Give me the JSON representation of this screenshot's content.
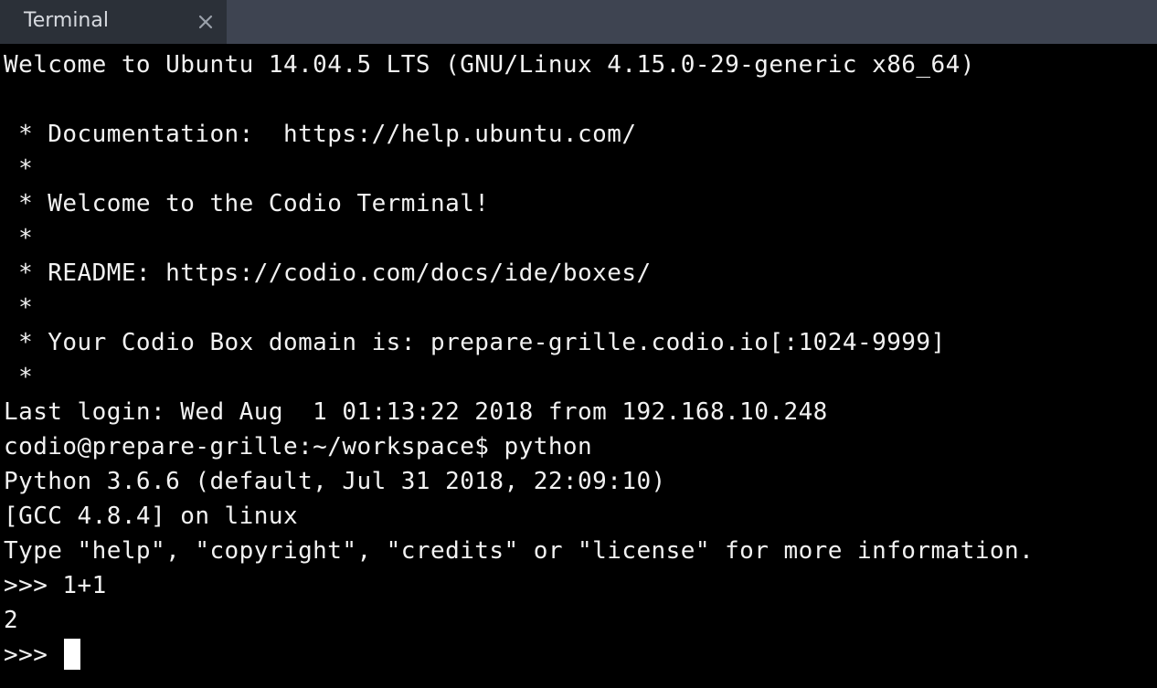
{
  "tab": {
    "label": "Terminal",
    "close_icon": "close-icon",
    "active_color": "#2b3038",
    "bar_color": "#3e4451"
  },
  "terminal": {
    "background": "#000000",
    "foreground": "#f2f2f2",
    "lines": [
      "Welcome to Ubuntu 14.04.5 LTS (GNU/Linux 4.15.0-29-generic x86_64)",
      "",
      " * Documentation:  https://help.ubuntu.com/",
      " *",
      " * Welcome to the Codio Terminal!",
      " *",
      " * README: https://codio.com/docs/ide/boxes/",
      " *",
      " * Your Codio Box domain is: prepare-grille.codio.io[:1024-9999]",
      " *",
      "Last login: Wed Aug  1 01:13:22 2018 from 192.168.10.248",
      "codio@prepare-grille:~/workspace$ python",
      "Python 3.6.6 (default, Jul 31 2018, 22:09:10)",
      "[GCC 4.8.4] on linux",
      "Type \"help\", \"copyright\", \"credits\" or \"license\" for more information.",
      ">>> 1+1",
      "2"
    ],
    "prompt": ">>> "
  }
}
